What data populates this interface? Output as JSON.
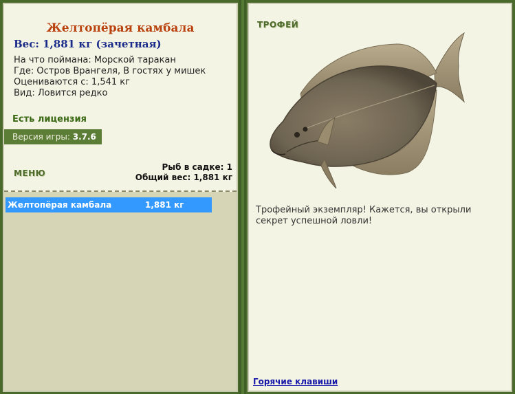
{
  "fish": {
    "name": "Желтопёрая камбала",
    "weight_line": "Вес: 1,881 кг (зачетная)",
    "bait": "На что поймана: Морской таракан",
    "location": "Где: Остров Врангеля, В гостях у мишек",
    "price": "Оцениваются с: 1,541 кг",
    "rarity": "Вид: Ловится редко"
  },
  "license": "Есть лицензия",
  "version": {
    "label": "Версия игры:",
    "value": "3.7.6"
  },
  "menu_label": "МЕНЮ",
  "stats": {
    "count": "Рыб в садке: 1",
    "total": "Общий вес: 1,881 кг"
  },
  "catch_list": [
    {
      "name": "Желтопёрая камбала",
      "weight": "1,881 кг"
    }
  ],
  "trophy": {
    "label": "ТРОФЕЙ",
    "text": "Трофейный экземпляр! Кажется, вы открыли секрет успешной ловли!"
  },
  "hotkeys_link": "Горячие клавиши"
}
